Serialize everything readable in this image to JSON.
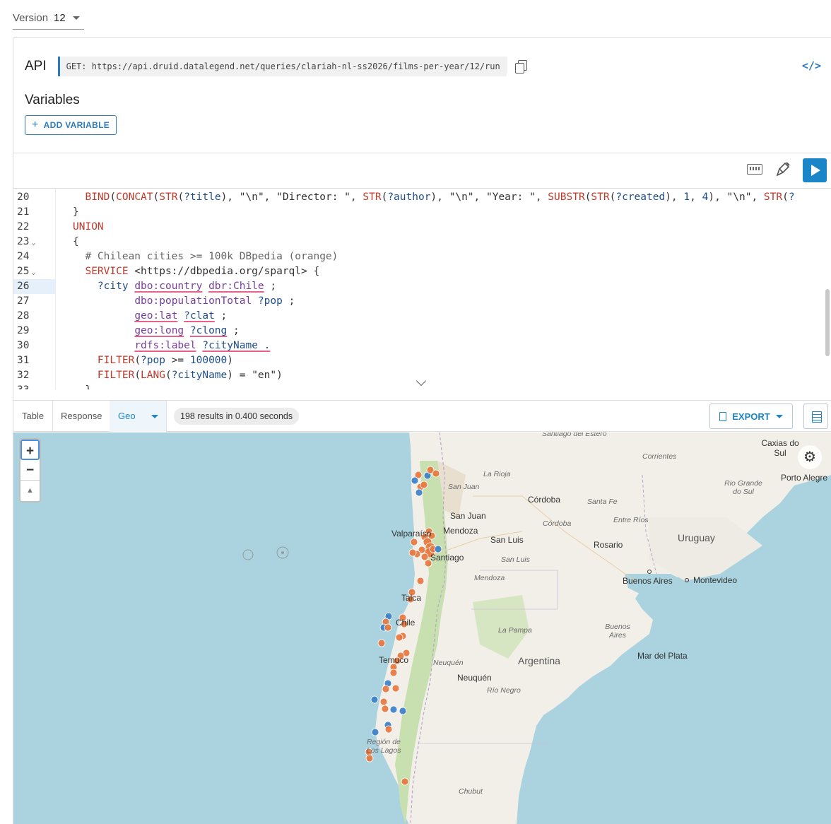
{
  "version": {
    "label": "Version",
    "value": "12"
  },
  "api": {
    "label": "API",
    "url": "GET: https://api.druid.datalegend.net/queries/clariah-nl-ss2026/films-per-year/12/run"
  },
  "variables": {
    "title": "Variables",
    "add_label": "ADD VARIABLE"
  },
  "editor": {
    "active_line": 26
  },
  "results": {
    "tabs": [
      "Table",
      "Response",
      "Geo"
    ],
    "active_tab": "Geo",
    "summary": "198 results in 0.400 seconds",
    "export_label": "EXPORT"
  },
  "map": {
    "labels": {
      "santiago_del_estero": "Santiago del Estero",
      "caxias_do_sul": "Caxias do Sul",
      "corrientes": "Corrientes",
      "porto_alegre": "Porto Alegre",
      "la_rioja": "La Rioja",
      "san_juan_prov": "San Juan",
      "cordoba": "Córdoba",
      "rio_grande_do_sul": "Rio Grande do Sul",
      "santa_fe": "Santa Fe",
      "san_juan": "San Juan",
      "cordoba_prov": "Córdoba",
      "entre_rios": "Entre Ríos",
      "valparaiso": "Valparaíso",
      "mendoza": "Mendoza",
      "san_luis": "San Luis",
      "uruguay": "Uruguay",
      "rosario": "Rosario",
      "santiago": "Santiago",
      "san_luis_prov": "San Luis",
      "mendoza_prov": "Mendoza",
      "buenos_aires": "Buenos Aires",
      "montevideo": "Montevideo",
      "talca": "Talca",
      "chile": "Chile",
      "la_pampa": "La Pampa",
      "buenos_aires_prov": "Buenos Aires",
      "mar_del_plata": "Mar del Plata",
      "temuco": "Temuco",
      "neuquen_prov": "Neuquén",
      "argentina": "Argentina",
      "neuquen": "Neuquén",
      "rio_negro": "Río Negro",
      "region_de_los_lagos": "Región de Los Lagos",
      "chubut": "Chubut"
    }
  }
}
